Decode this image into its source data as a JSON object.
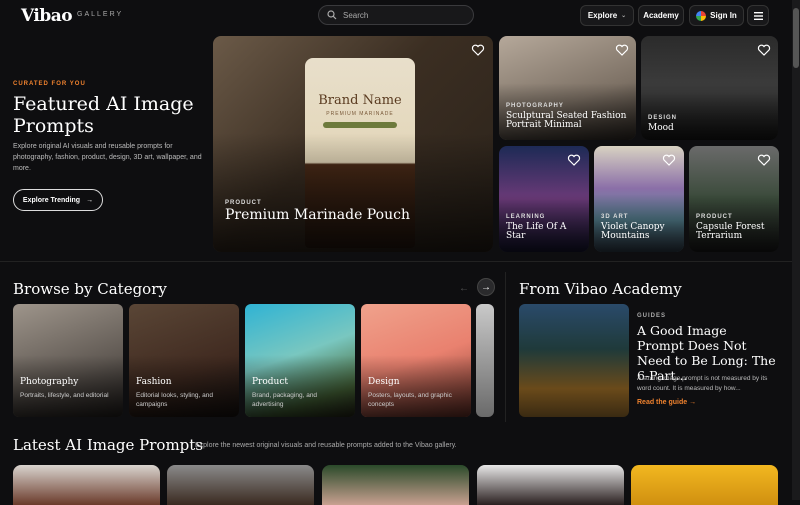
{
  "header": {
    "logo": "Vibao",
    "logo_sub": "GALLERY",
    "search_placeholder": "Search",
    "explore": "Explore",
    "academy": "Academy",
    "signin": "Sign In"
  },
  "hero": {
    "kicker": "CURATED FOR YOU",
    "title": "Featured AI Image Prompts",
    "desc": "Explore original AI visuals and reusable prompts for photography, fashion, product, design, 3D art, wallpaper, and more.",
    "cta": "Explore Trending"
  },
  "featured": {
    "main": {
      "category": "PRODUCT",
      "title": "Premium Marinade Pouch",
      "pouch_brand": "Brand Name",
      "pouch_sub": "PREMIUM MARINADE"
    },
    "cards": [
      {
        "category": "PHOTOGRAPHY",
        "title": "Sculptural Seated Fashion Portrait Minimal"
      },
      {
        "category": "DESIGN",
        "title": "Mood"
      },
      {
        "category": "LEARNING",
        "title": "The Life Of A Star"
      },
      {
        "category": "3D ART",
        "title": "Violet Canopy Mountains"
      },
      {
        "category": "PRODUCT",
        "title": "Capsule Forest Terrarium"
      }
    ]
  },
  "browse": {
    "title": "Browse by Category",
    "categories": [
      {
        "name": "Photography",
        "desc": "Portraits, lifestyle, and editorial"
      },
      {
        "name": "Fashion",
        "desc": "Editorial looks, styling, and campaigns"
      },
      {
        "name": "Product",
        "desc": "Brand, packaging, and advertising"
      },
      {
        "name": "Design",
        "desc": "Posters, layouts, and graphic concepts"
      }
    ]
  },
  "academy": {
    "title": "From Vibao Academy",
    "kicker": "GUIDES",
    "post_title": "A Good Image Prompt Does Not Need to Be Long: The 6-Part...",
    "post_desc": "A strong image prompt is not measured by its word count. It is measured by how...",
    "link": "Read the guide"
  },
  "latest": {
    "title": "Latest AI Image Prompts",
    "desc": "Explore the newest original visuals and reusable prompts added to the Vibao gallery."
  },
  "colors": {
    "accent": "#f0822e",
    "bg": "#0e0e10"
  }
}
